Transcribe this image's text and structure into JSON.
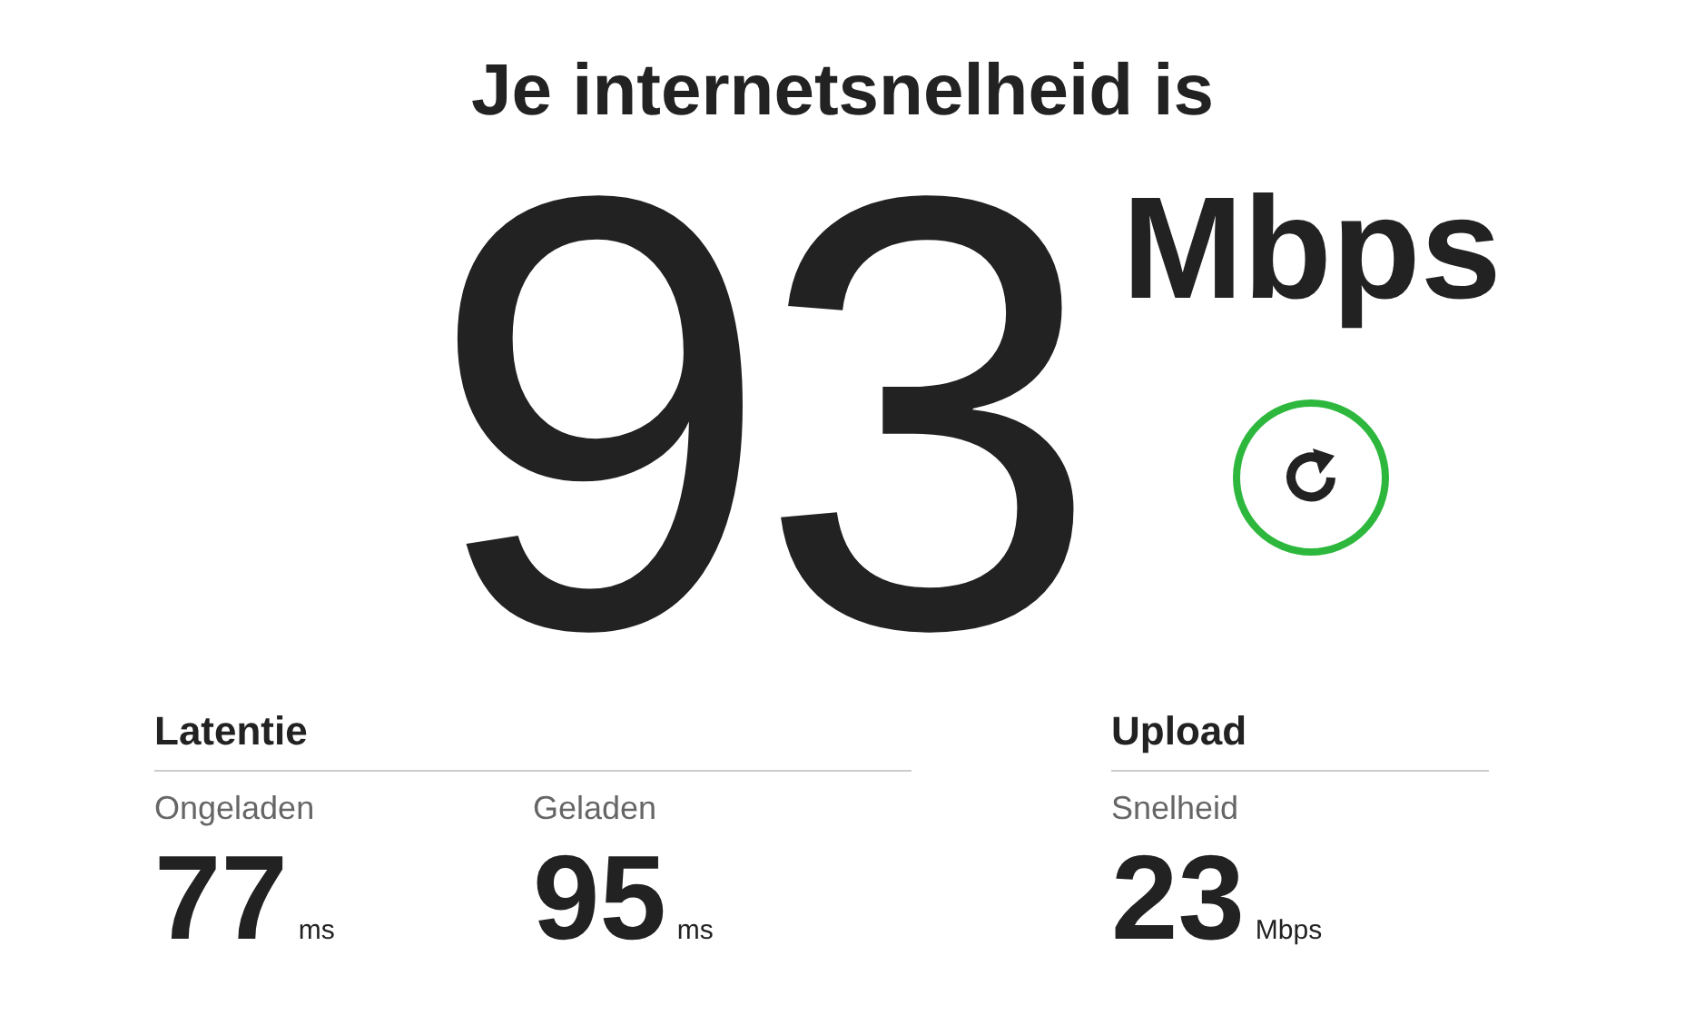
{
  "title": "Je internetsnelheid is",
  "speed": {
    "value": "93",
    "unit": "Mbps"
  },
  "sections": [
    {
      "title": "Latentie",
      "metrics": [
        {
          "label": "Ongeladen",
          "value": "77",
          "unit": "ms"
        },
        {
          "label": "Geladen",
          "value": "95",
          "unit": "ms"
        }
      ]
    },
    {
      "title": "Upload",
      "metrics": [
        {
          "label": "Snelheid",
          "value": "23",
          "unit": "Mbps"
        }
      ]
    }
  ]
}
